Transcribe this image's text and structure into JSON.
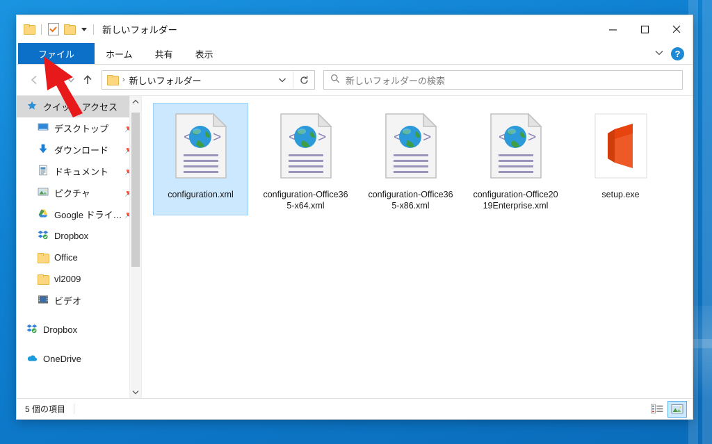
{
  "window": {
    "title": "新しいフォルダー",
    "quick_access": [
      {
        "name": "folder-icon",
        "label": "フォルダー"
      },
      {
        "name": "properties-icon",
        "label": "プロパティ"
      },
      {
        "name": "new-folder-icon",
        "label": "新しいフォルダー"
      },
      {
        "name": "qat-dropdown-icon",
        "label": "クイック アクセス ツール バーのユーザー設定"
      }
    ],
    "controls": {
      "minimize": "最小化",
      "maximize": "最大化",
      "close": "閉じる"
    }
  },
  "ribbon": {
    "tabs": [
      {
        "label": "ファイル",
        "active": true
      },
      {
        "label": "ホーム",
        "active": false
      },
      {
        "label": "共有",
        "active": false
      },
      {
        "label": "表示",
        "active": false
      }
    ],
    "collapse_label": "リボンの最小化",
    "help_label": "?"
  },
  "address": {
    "back_label": "戻る",
    "forward_label": "進む",
    "recent_label": "最近表示した場所",
    "up_label": "上へ",
    "breadcrumb": [
      "新しいフォルダー"
    ],
    "breadcrumb_separator": "›",
    "dropdown_label": "以前の場所",
    "refresh_label": "最新の情報に更新"
  },
  "search": {
    "placeholder": "新しいフォルダーの検索",
    "value": ""
  },
  "sidebar": {
    "items": [
      {
        "label": "クイック アクセス",
        "icon": "star-icon",
        "selected": true,
        "indent": 0,
        "pinned": false
      },
      {
        "label": "デスクトップ",
        "icon": "desktop-icon",
        "selected": false,
        "indent": 1,
        "pinned": true
      },
      {
        "label": "ダウンロード",
        "icon": "download-icon",
        "selected": false,
        "indent": 1,
        "pinned": true
      },
      {
        "label": "ドキュメント",
        "icon": "documents-icon",
        "selected": false,
        "indent": 1,
        "pinned": true
      },
      {
        "label": "ピクチャ",
        "icon": "pictures-icon",
        "selected": false,
        "indent": 1,
        "pinned": true
      },
      {
        "label": "Google ドライ…",
        "icon": "google-drive-icon",
        "selected": false,
        "indent": 1,
        "pinned": true
      },
      {
        "label": "Dropbox",
        "icon": "dropbox-icon",
        "selected": false,
        "indent": 1,
        "pinned": false
      },
      {
        "label": "Office",
        "icon": "folder-icon",
        "selected": false,
        "indent": 1,
        "pinned": false
      },
      {
        "label": "vl2009",
        "icon": "folder-icon",
        "selected": false,
        "indent": 1,
        "pinned": false
      },
      {
        "label": "ビデオ",
        "icon": "videos-icon",
        "selected": false,
        "indent": 1,
        "pinned": false
      },
      {
        "label": "Dropbox",
        "icon": "dropbox-icon",
        "selected": false,
        "indent": 0,
        "pinned": false,
        "gap_before": true
      },
      {
        "label": "OneDrive",
        "icon": "onedrive-icon",
        "selected": false,
        "indent": 0,
        "pinned": false,
        "gap_before": true
      }
    ],
    "scroll_up_label": "上にスクロール",
    "scroll_down_label": "下にスクロール"
  },
  "files": [
    {
      "name": "configuration.xml",
      "icon": "xml-file-icon",
      "selected": true
    },
    {
      "name": "configuration-Office365-x64.xml",
      "icon": "xml-file-icon",
      "selected": false
    },
    {
      "name": "configuration-Office365-x86.xml",
      "icon": "xml-file-icon",
      "selected": false
    },
    {
      "name": "configuration-Office2019Enterprise.xml",
      "icon": "xml-file-icon",
      "selected": false
    },
    {
      "name": "setup.exe",
      "icon": "office-app-icon",
      "selected": false
    }
  ],
  "statusbar": {
    "item_count_text": "5 個の項目",
    "views": [
      {
        "name": "details-view-button",
        "label": "詳細表示",
        "active": false
      },
      {
        "name": "large-icons-view-button",
        "label": "大アイコン表示",
        "active": true
      }
    ]
  },
  "annotation": {
    "arrow_color": "#e8191b",
    "points_at": "ファイル"
  },
  "colors": {
    "accent_blue": "#0d70c8",
    "selection_blue": "#cce8ff",
    "desktop_blue": "#0f7fd0",
    "office_orange": "#e8440f"
  }
}
